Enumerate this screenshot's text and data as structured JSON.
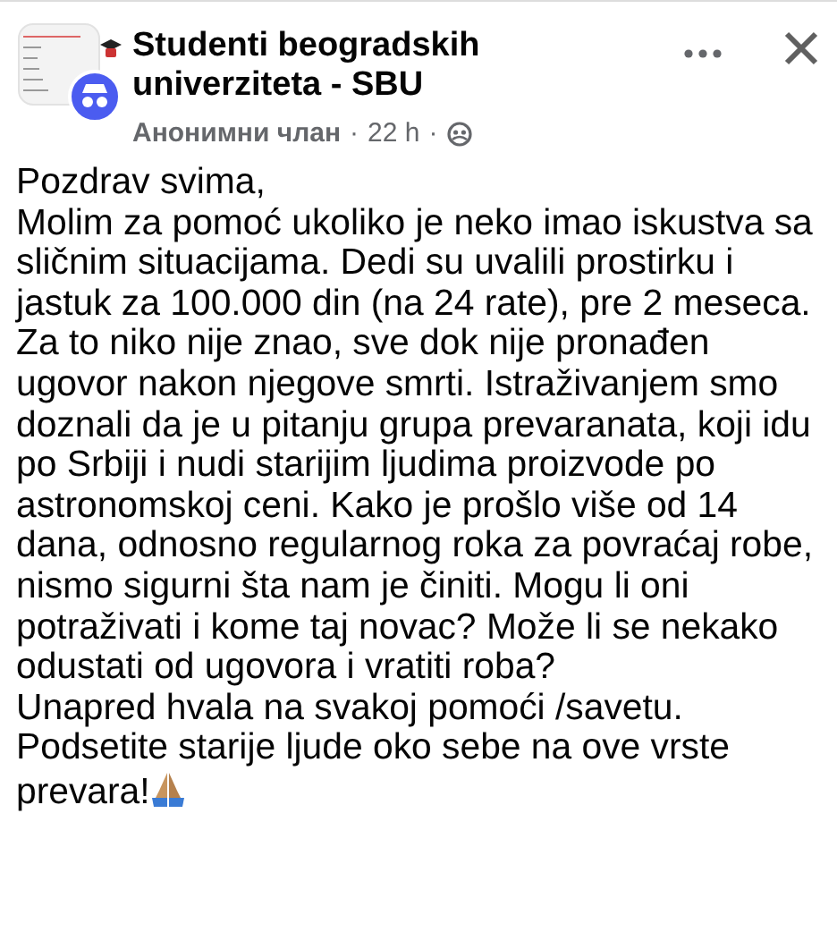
{
  "post": {
    "group_name": "Studenti beogradskih univerziteta - SBU",
    "author": "Анонимни члан",
    "separator": "·",
    "time": "22 h",
    "paragraphs": [
      "Pozdrav svima,",
      "Molim za pomoć ukoliko je neko imao iskustva sa sličnim situacijama. Dedi su uvalili prostirku i jastuk za 100.000 din (na 24 rate), pre 2 meseca. Za to niko nije znao, sve dok nije pronađen ugovor nakon njegove smrti. Istraživanjem smo doznali da je u pitanju grupa prevaranata, koji idu po Srbiji i nudi starijim ljudima proizvode po astronomskoj ceni. Kako je prošlo više od 14 dana, odnosno regularnog roka za povraćaj robe, nismo sigurni šta nam je činiti. Mogu li oni potraživati i kome taj novac? Može li se nekako odustati od ugovora i vratiti roba?",
      "Unapred hvala na svakoj pomoći /savetu.",
      "Podsetite starije ljude oko sebe na ove vrste prevara!"
    ]
  }
}
